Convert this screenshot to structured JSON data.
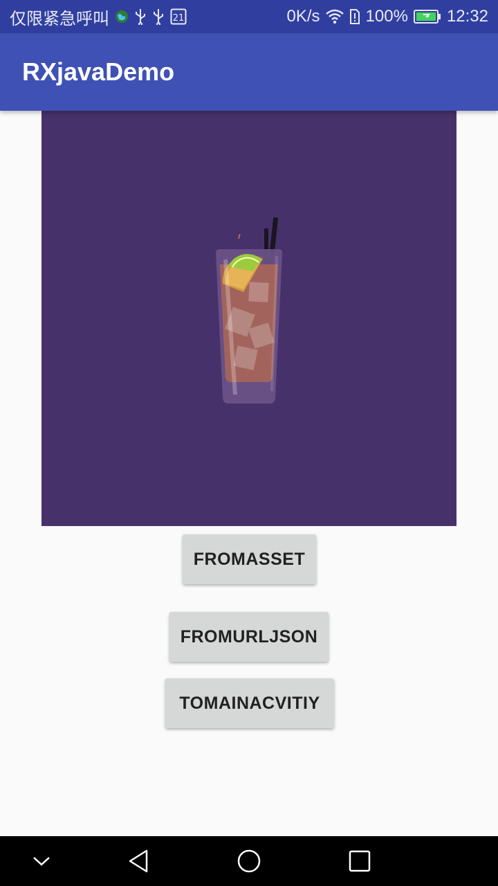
{
  "status_bar": {
    "left_text": "仅限紧急呼叫",
    "notification_badge": "21",
    "net_speed": "0K/s",
    "battery": "100%",
    "time": "12:32",
    "icons": [
      "globe-icon",
      "usb-icon",
      "usb-icon",
      "calendar-icon",
      "wifi-icon",
      "sim-alert-icon",
      "battery-charging-icon"
    ]
  },
  "toolbar": {
    "title": "RXjavaDemo"
  },
  "image": {
    "description_icon": "cocktail-illustration",
    "background_color": "#47316a"
  },
  "buttons": {
    "from_asset": "FROMASSET",
    "from_url_json": "FROMURLJSON",
    "to_main_activity": "TOMAINACVITIY"
  },
  "nav_bar": {
    "icons": [
      "chevron-down-icon",
      "back-icon",
      "home-icon",
      "recents-icon"
    ]
  },
  "colors": {
    "primary": "#3f51b5",
    "primary_dark": "#303f9f",
    "button": "#d6d7d7"
  }
}
